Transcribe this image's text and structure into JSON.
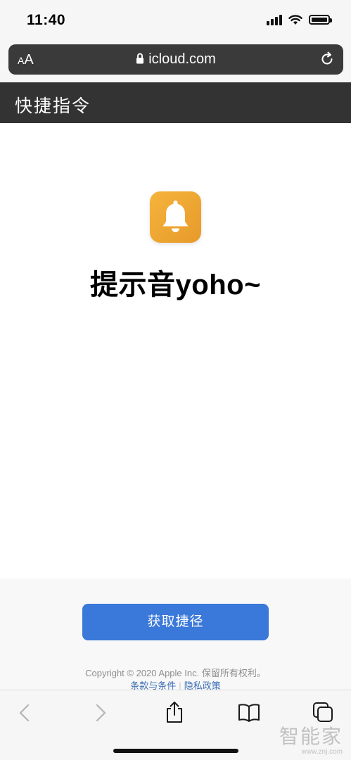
{
  "status_bar": {
    "time": "11:40"
  },
  "address_bar": {
    "text_size_button": "AA",
    "url": "icloud.com"
  },
  "title_bar": {
    "title": "快捷指令"
  },
  "shortcut": {
    "name": "提示音yoho~",
    "icon": "bell-icon",
    "icon_color": "#F0A832"
  },
  "footer": {
    "get_button": "获取捷径",
    "copyright": "Copyright © 2020 Apple Inc. 保留所有权利。",
    "terms_link": "条款与条件",
    "privacy_link": "隐私政策",
    "button_color": "#3A78D9"
  },
  "toolbar": {
    "back": "chevron-left-icon",
    "forward": "chevron-right-icon",
    "share": "share-icon",
    "bookmarks": "book-icon",
    "tabs": "tabs-icon"
  },
  "watermark": {
    "brand": "智能家",
    "site": "www.znj.com"
  }
}
